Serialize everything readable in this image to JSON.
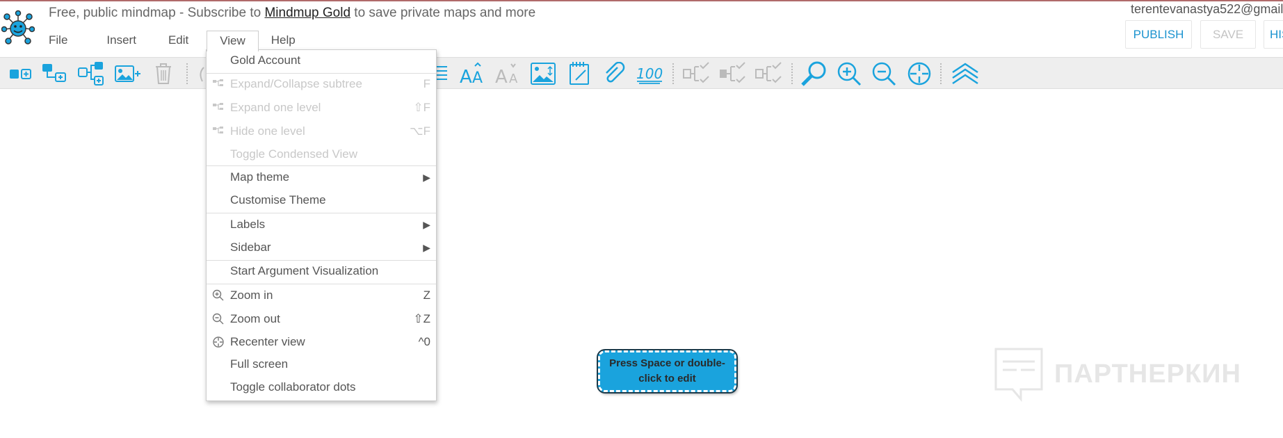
{
  "header": {
    "banner_prefix": "Free, public mindmap - Subscribe to ",
    "banner_link": "Mindmup Gold",
    "banner_suffix": " to save private maps and more",
    "user_email": "terentevanastya522@gmail",
    "publish_label": "PUBLISH",
    "save_label": "SAVE",
    "hist_label": "HIS"
  },
  "menubar": {
    "file": "File",
    "insert": "Insert",
    "edit": "Edit",
    "view": "View",
    "help": "Help"
  },
  "view_menu": {
    "items": [
      {
        "label": "Gold Account",
        "shortcut": "",
        "disabled": false
      },
      {
        "label": "Expand/Collapse subtree",
        "shortcut": "F",
        "disabled": true
      },
      {
        "label": "Expand one level",
        "shortcut": "⇧F",
        "disabled": true
      },
      {
        "label": "Hide one level",
        "shortcut": "⌥F",
        "disabled": true
      },
      {
        "label": "Toggle Condensed View",
        "shortcut": "",
        "disabled": true
      },
      {
        "label": "Map theme",
        "shortcut": "▶",
        "disabled": false
      },
      {
        "label": "Customise Theme",
        "shortcut": "",
        "disabled": false
      },
      {
        "label": "Labels",
        "shortcut": "▶",
        "disabled": false
      },
      {
        "label": "Sidebar",
        "shortcut": "▶",
        "disabled": false
      },
      {
        "label": "Start Argument Visualization",
        "shortcut": "",
        "disabled": false
      },
      {
        "label": "Zoom in",
        "shortcut": "Z",
        "disabled": false
      },
      {
        "label": "Zoom out",
        "shortcut": "⇧Z",
        "disabled": false
      },
      {
        "label": "Recenter view",
        "shortcut": "^0",
        "disabled": false
      },
      {
        "label": "Full screen",
        "shortcut": "",
        "disabled": false
      },
      {
        "label": "Toggle collaborator dots",
        "shortcut": "",
        "disabled": false
      }
    ]
  },
  "canvas": {
    "node_text": "Press Space or double-click to edit",
    "watermark_text": "ПАРТНЕРКИН"
  },
  "colors": {
    "accent": "#1b93cf",
    "node_fill": "#1aa3dd",
    "toolbar_bg": "#eeeeee",
    "disabled_text": "#c8c8c8"
  },
  "icons": {
    "logo": "mindmup-logo-icon",
    "toolbar": [
      "add-child-node-icon",
      "add-sibling-node-icon",
      "add-parent-node-icon",
      "insert-image-icon",
      "delete-icon",
      "undo-icon",
      "list-icon",
      "font-size-increase-icon",
      "font-size-decrease-icon",
      "node-image-icon",
      "note-icon",
      "attachment-icon",
      "progress-100-icon",
      "collapse-checklist-icon",
      "collapse-checklist-2-icon",
      "collapse-checklist-3-icon",
      "search-icon",
      "zoom-in-icon",
      "zoom-out-icon",
      "recenter-icon",
      "layers-icon"
    ]
  }
}
